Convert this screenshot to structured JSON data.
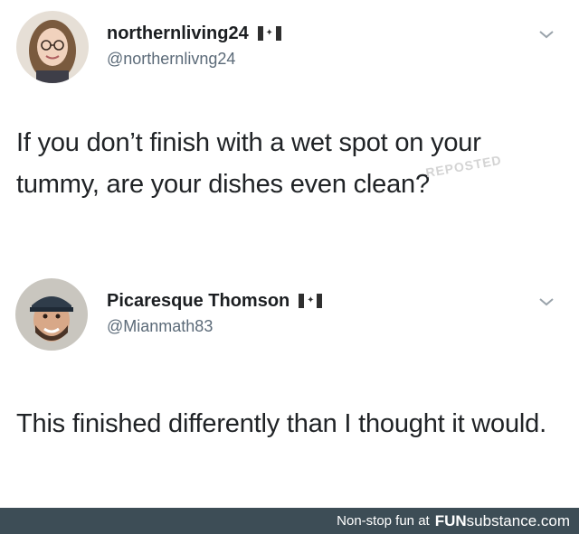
{
  "tweets": [
    {
      "display_name": "northernliving24",
      "handle": "@northernlivng24",
      "flag_icon": "canada-flag-icon",
      "text": "If you don’t finish with a wet spot on your tummy, are your dishes even clean?"
    },
    {
      "display_name": "Picaresque Thomson",
      "handle": "@Mianmath83",
      "flag_icon": "canada-flag-icon",
      "text": "This finished differently than I thought it would."
    }
  ],
  "watermark": "REPOSTED",
  "footer": {
    "tagline": "Non-stop fun at",
    "brand_prefix": "FUN",
    "brand_suffix": "substance.com"
  },
  "colors": {
    "footer_bg": "#3d4d56",
    "handle": "#5b6a78",
    "text": "#202326"
  }
}
